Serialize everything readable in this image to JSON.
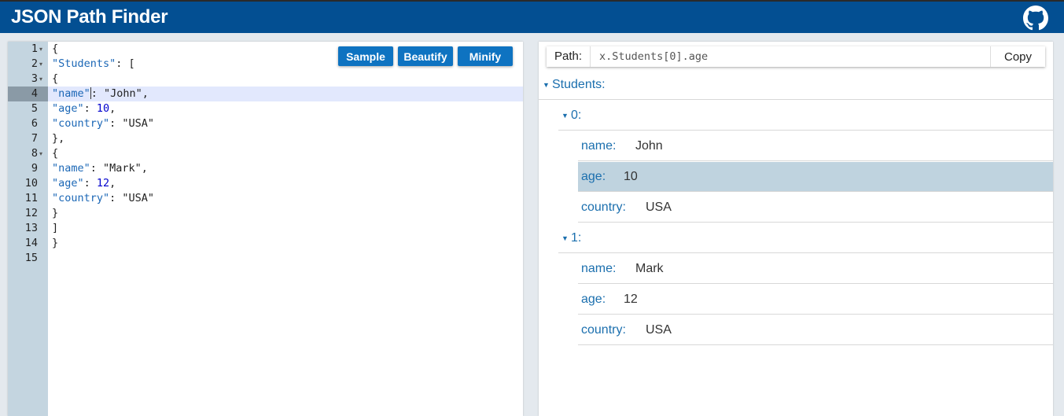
{
  "app": {
    "title": "JSON Path Finder"
  },
  "editor": {
    "buttons": {
      "sample": "Sample",
      "beautify": "Beautify",
      "minify": "Minify"
    },
    "lines": [
      {
        "num": "1",
        "fold": true
      },
      {
        "num": "2",
        "fold": true
      },
      {
        "num": "3",
        "fold": true
      },
      {
        "num": "4",
        "fold": false,
        "active": true
      },
      {
        "num": "5",
        "fold": false
      },
      {
        "num": "6",
        "fold": false
      },
      {
        "num": "7",
        "fold": false
      },
      {
        "num": "8",
        "fold": true
      },
      {
        "num": "9",
        "fold": false
      },
      {
        "num": "10",
        "fold": false
      },
      {
        "num": "11",
        "fold": false
      },
      {
        "num": "12",
        "fold": false
      },
      {
        "num": "13",
        "fold": false
      },
      {
        "num": "14",
        "fold": false
      },
      {
        "num": "15",
        "fold": false
      }
    ],
    "text": {
      "l1_brace": "{",
      "l2_key": "\"Students\"",
      "l2_rest": ": [",
      "l3_brace": "{",
      "l4_key": "\"name\"",
      "l4_rest": ": \"John\",",
      "l5_key": "\"age\"",
      "l5_sep": ": ",
      "l5_num": "10",
      "l5_comma": ",",
      "l6_key": "\"country\"",
      "l6_rest": ": \"USA\"",
      "l7": "},",
      "l8": "{",
      "l9_key": "\"name\"",
      "l9_rest": ": \"Mark\",",
      "l10_key": "\"age\"",
      "l10_sep": ": ",
      "l10_num": "12",
      "l10_comma": ",",
      "l11_key": "\"country\"",
      "l11_rest": ": \"USA\"",
      "l12": "}",
      "l13": "]",
      "l14": "}",
      "l15": ""
    }
  },
  "path": {
    "label": "Path:",
    "value": "x.Students[0].age",
    "copy_label": "Copy"
  },
  "tree": {
    "root_key": "Students:",
    "items": [
      {
        "index_label": "0:",
        "fields": [
          {
            "key": "name:",
            "value": "John",
            "selected": false
          },
          {
            "key": "age:",
            "value": "10",
            "selected": true
          },
          {
            "key": "country:",
            "value": "USA",
            "selected": false
          }
        ]
      },
      {
        "index_label": "1:",
        "fields": [
          {
            "key": "name:",
            "value": "Mark",
            "selected": false
          },
          {
            "key": "age:",
            "value": "12",
            "selected": false
          },
          {
            "key": "country:",
            "value": "USA",
            "selected": false
          }
        ]
      }
    ]
  },
  "icons": {
    "github": "github-icon",
    "fold": "fold-arrow-icon",
    "caret": "caret-down-icon"
  },
  "colors": {
    "header": "#034f92",
    "button": "#0e73c1",
    "selected_row": "#bfd3df",
    "tree_key": "#1b6fae"
  }
}
